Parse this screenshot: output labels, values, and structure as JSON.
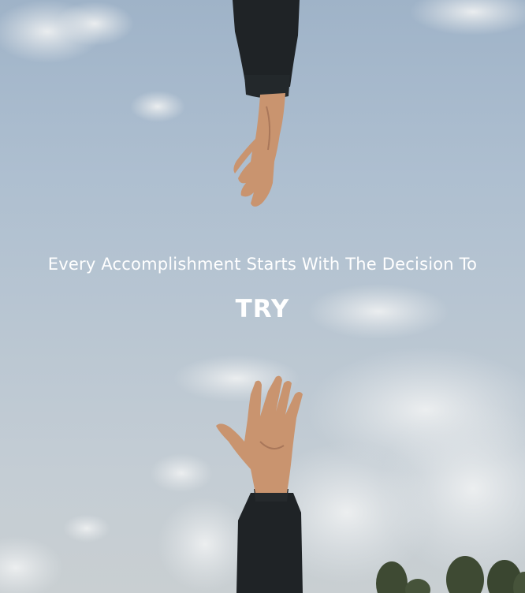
{
  "hero": {
    "headline": "Every Accomplishment Starts With The Decision To",
    "emphasis": "TRY"
  },
  "colors": {
    "sky_top": "#9fb3c8",
    "sky_bottom": "#c9cfd2",
    "sleeve": "#1f2326",
    "skin": "#c9946f",
    "text": "#ffffff",
    "tree": "#3e4a33"
  }
}
